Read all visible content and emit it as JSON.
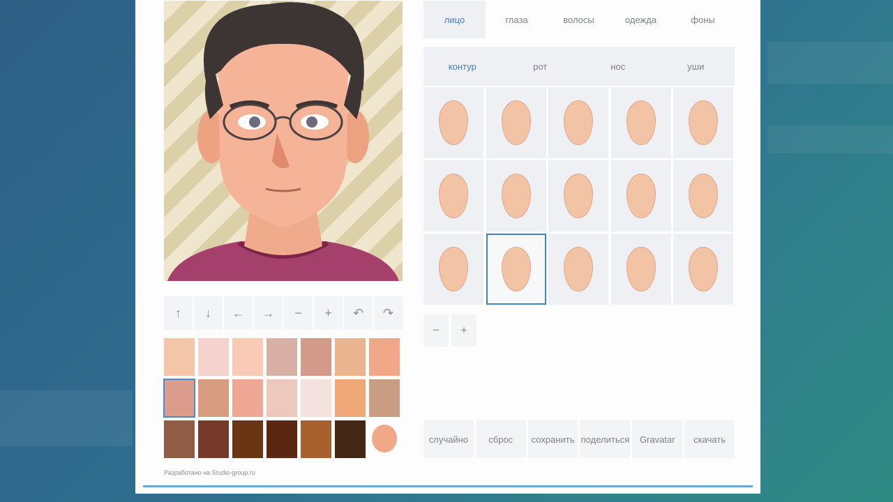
{
  "tabs": [
    {
      "label": "лицо",
      "active": true
    },
    {
      "label": "глаза",
      "active": false
    },
    {
      "label": "волосы",
      "active": false
    },
    {
      "label": "одежда",
      "active": false
    },
    {
      "label": "фоны",
      "active": false
    }
  ],
  "subtabs": [
    {
      "label": "контур",
      "active": true
    },
    {
      "label": "рот",
      "active": false
    },
    {
      "label": "нос",
      "active": false
    },
    {
      "label": "уши",
      "active": false
    }
  ],
  "toolbar": [
    {
      "icon": "arrow-up-icon",
      "glyph": "↑"
    },
    {
      "icon": "arrow-down-icon",
      "glyph": "↓"
    },
    {
      "icon": "arrow-left-icon",
      "glyph": "←"
    },
    {
      "icon": "arrow-right-icon",
      "glyph": "→"
    },
    {
      "icon": "zoom-out-icon",
      "glyph": "−"
    },
    {
      "icon": "zoom-in-icon",
      "glyph": "+"
    },
    {
      "icon": "undo-icon",
      "glyph": "↶"
    },
    {
      "icon": "redo-icon",
      "glyph": "↷"
    }
  ],
  "shape_grid": {
    "rows": 3,
    "cols": 5,
    "selected": [
      2,
      1
    ]
  },
  "zoom_controls": [
    {
      "icon": "zoom-out-icon",
      "glyph": "−"
    },
    {
      "icon": "zoom-in-icon",
      "glyph": "+"
    }
  ],
  "palette": {
    "rows": [
      [
        "#f3c6a9",
        "#f5d2cd",
        "#f9cbb7",
        "#d9b0a6",
        "#d49b8b",
        "#e9b48e",
        "#f0a888"
      ],
      [
        "#dc9c8c",
        "#d89d80",
        "#f0a795",
        "#ecc8bd",
        "#f5e1dd",
        "#f1a879",
        "#c99c84"
      ],
      [
        "#915c44",
        "#753a2a",
        "#6a3512",
        "#5b2713",
        "#a9602f",
        "#432714"
      ]
    ],
    "selected": [
      1,
      0
    ],
    "current_color": "#f0a888"
  },
  "actions": [
    "случайно",
    "сброс",
    "сохранить",
    "поделиться",
    "Gravatar",
    "скачать"
  ],
  "credit": "Разработано на Studio-group.ru"
}
